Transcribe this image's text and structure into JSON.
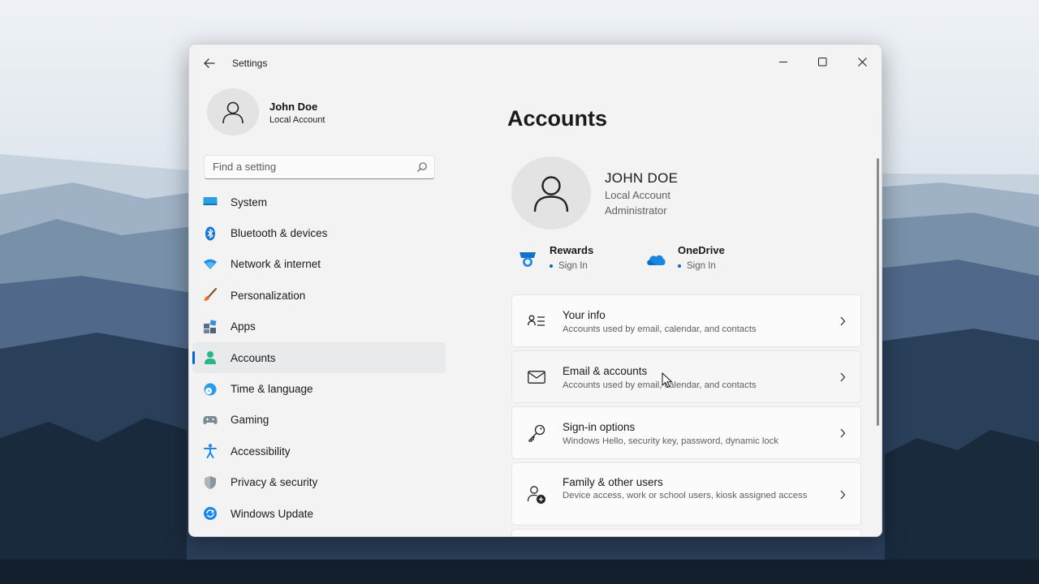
{
  "window": {
    "title": "Settings",
    "controls": {
      "minimize": "minimize",
      "maximize": "maximize",
      "close": "close"
    }
  },
  "profile": {
    "name": "John Doe",
    "account_type": "Local Account"
  },
  "search": {
    "placeholder": "Find a setting",
    "value": ""
  },
  "nav": {
    "items": [
      {
        "label": "System",
        "icon": "system-icon",
        "active": false
      },
      {
        "label": "Bluetooth & devices",
        "icon": "bluetooth-icon",
        "active": false
      },
      {
        "label": "Network & internet",
        "icon": "wifi-icon",
        "active": false
      },
      {
        "label": "Personalization",
        "icon": "brush-icon",
        "active": false
      },
      {
        "label": "Apps",
        "icon": "apps-icon",
        "active": false
      },
      {
        "label": "Accounts",
        "icon": "person-icon",
        "active": true
      },
      {
        "label": "Time & language",
        "icon": "globe-clock-icon",
        "active": false
      },
      {
        "label": "Gaming",
        "icon": "gamepad-icon",
        "active": false
      },
      {
        "label": "Accessibility",
        "icon": "accessibility-icon",
        "active": false
      },
      {
        "label": "Privacy & security",
        "icon": "shield-icon",
        "active": false
      },
      {
        "label": "Windows Update",
        "icon": "update-icon",
        "active": false
      }
    ]
  },
  "main": {
    "title": "Accounts",
    "account": {
      "name": "JOHN DOE",
      "type": "Local Account",
      "role": "Administrator"
    },
    "services": [
      {
        "name": "Rewards",
        "status": "Sign In",
        "icon": "rewards-icon"
      },
      {
        "name": "OneDrive",
        "status": "Sign In",
        "icon": "onedrive-icon"
      }
    ],
    "cards": [
      {
        "title": "Your info",
        "desc": "Accounts used by email, calendar, and contacts",
        "icon": "contact-card-icon"
      },
      {
        "title": "Email & accounts",
        "desc": "Accounts used by email, calendar, and contacts",
        "icon": "mail-icon"
      },
      {
        "title": "Sign-in options",
        "desc": "Windows Hello, security key, password, dynamic lock",
        "icon": "key-icon"
      },
      {
        "title": "Family & other users",
        "desc": "Device access, work or school users, kiosk assigned access",
        "icon": "add-person-icon"
      }
    ]
  },
  "colors": {
    "accent": "#0067c0",
    "window_bg": "#f3f3f3",
    "card_bg": "#fbfbfb"
  }
}
